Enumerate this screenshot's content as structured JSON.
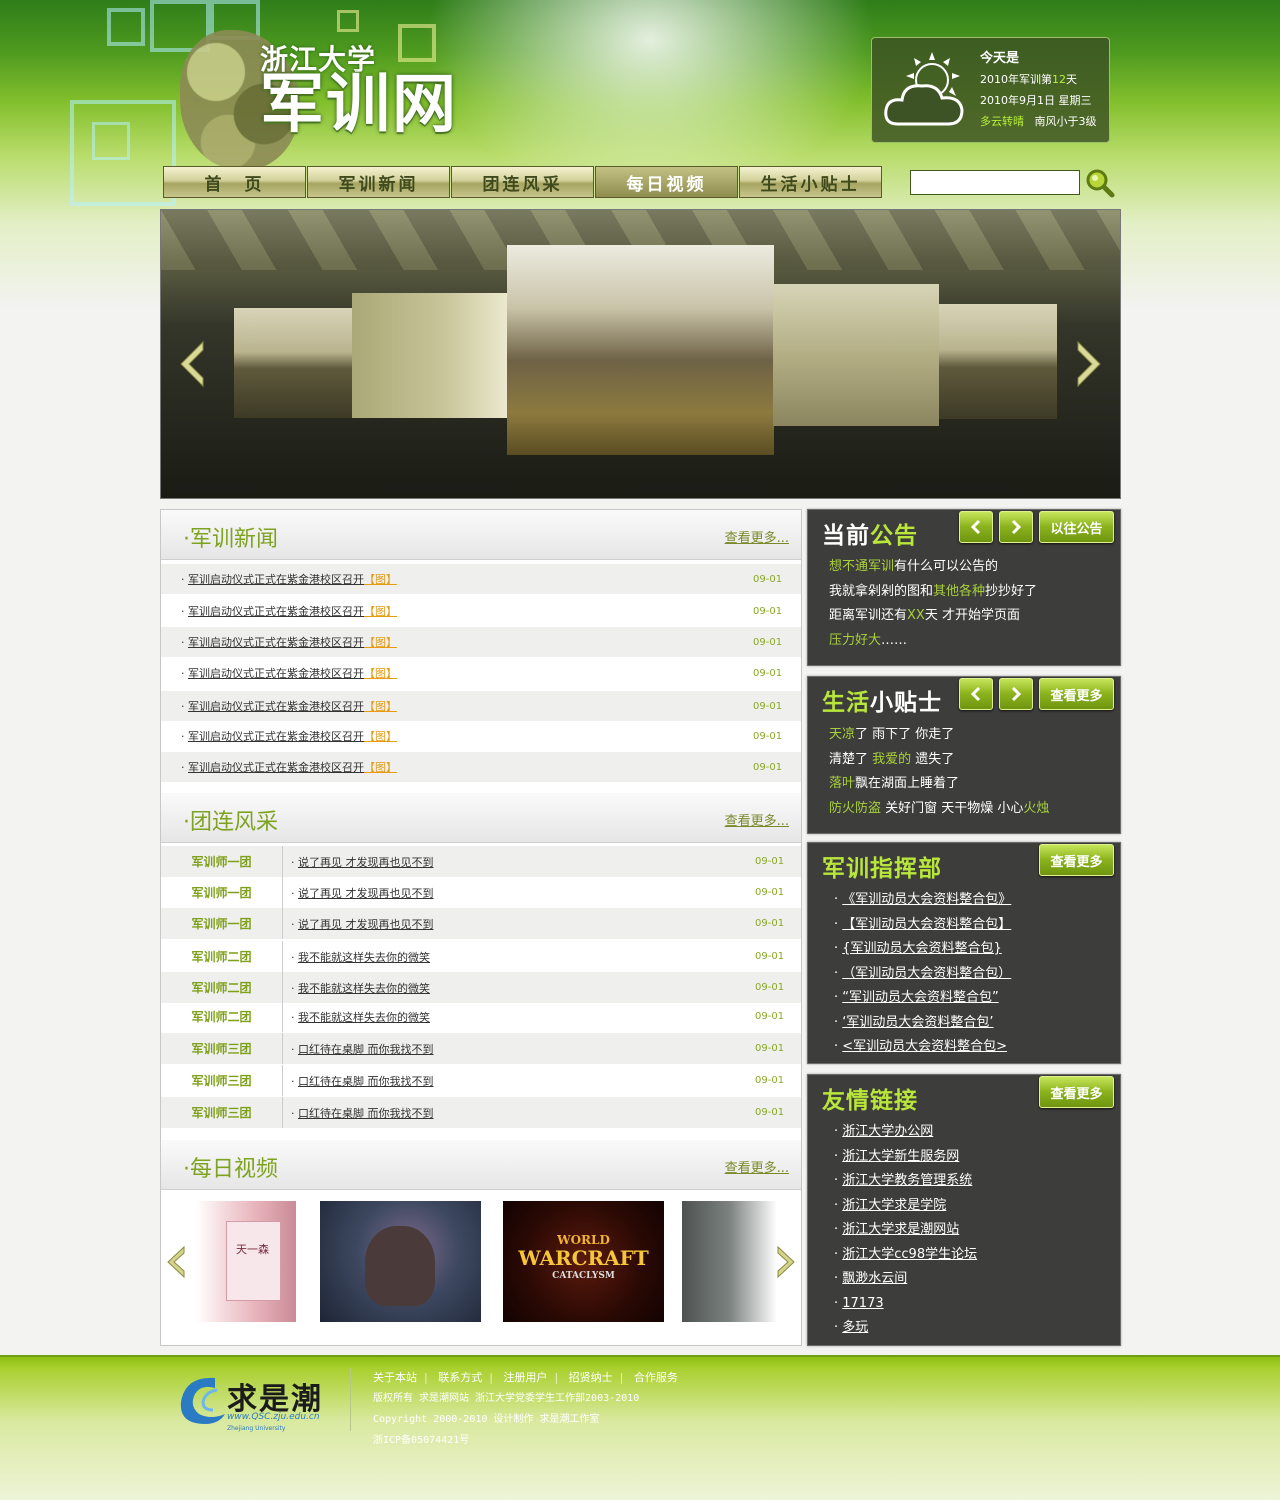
{
  "header": {
    "logo_small": "浙江大学",
    "logo_big": "军训网"
  },
  "weather": {
    "title": "今天是",
    "line1_prefix": "2010年军训第",
    "line1_day": "12",
    "line1_suffix": "天",
    "line2": "2010年9月1日  星期三",
    "condition": "多云转晴",
    "wind": "南风小于3级",
    "icon": "partly-cloudy-icon"
  },
  "nav": {
    "items": [
      {
        "label": "首　页"
      },
      {
        "label": "军训新闻"
      },
      {
        "label": "团连风采"
      },
      {
        "label": "每日视频"
      },
      {
        "label": "生活小贴士"
      }
    ],
    "search_placeholder": ""
  },
  "news": {
    "title": "·军训新闻",
    "more": "查看更多...",
    "img_tag": "【图】",
    "items": [
      {
        "title": "军训启动仪式正式在紫金港校区召开",
        "date": "09-01"
      },
      {
        "title": "军训启动仪式正式在紫金港校区召开",
        "date": "09-01"
      },
      {
        "title": "军训启动仪式正式在紫金港校区召开",
        "date": "09-01"
      },
      {
        "title": "军训启动仪式正式在紫金港校区召开",
        "date": "09-01"
      },
      {
        "title": "军训启动仪式正式在紫金港校区召开",
        "date": "09-01"
      },
      {
        "title": "军训启动仪式正式在紫金港校区召开",
        "date": "09-01"
      },
      {
        "title": "军训启动仪式正式在紫金港校区召开",
        "date": "09-01"
      }
    ]
  },
  "tuanlian": {
    "title": "·团连风采",
    "more": "查看更多...",
    "items": [
      {
        "unit": "军训师一团",
        "title": "说了再见  才发现再也见不到",
        "date": "09-01"
      },
      {
        "unit": "军训师一团",
        "title": "说了再见  才发现再也见不到",
        "date": "09-01"
      },
      {
        "unit": "军训师一团",
        "title": "说了再见  才发现再也见不到",
        "date": "09-01"
      },
      {
        "unit": "军训师二团",
        "title": "我不能就这样失去你的微笑",
        "date": "09-01"
      },
      {
        "unit": "军训师二团",
        "title": "我不能就这样失去你的微笑",
        "date": "09-01"
      },
      {
        "unit": "军训师二团",
        "title": "我不能就这样失去你的微笑",
        "date": "09-01"
      },
      {
        "unit": "军训师三团",
        "title": "口红待在桌脚  而你我找不到",
        "date": "09-01"
      },
      {
        "unit": "军训师三团",
        "title": "口红待在桌脚  而你我找不到",
        "date": "09-01"
      },
      {
        "unit": "军训师三团",
        "title": "口红待在桌脚  而你我找不到",
        "date": "09-01"
      }
    ]
  },
  "video": {
    "title": "·每日视频",
    "more": "查看更多...",
    "thumb1_text": "天一森",
    "thumb3_line1": "WORLD",
    "thumb3_line2": "WARCRAFT",
    "thumb3_line3": "CATACLYSM"
  },
  "notice": {
    "title_a": "当前",
    "title_b": "公告",
    "btn": "以往公告",
    "l1_a": "想不通军训",
    "l1_b": "有什么可以公告的",
    "l2_a": "我就拿剁剁的图和",
    "l2_b": "其他各种",
    "l2_c": "抄抄好了",
    "l3_a": "距离军训还有",
    "l3_b": "XX",
    "l3_c": "天  才开始学页面",
    "l4_a": "压力好大",
    "l4_b": "……"
  },
  "tips": {
    "title_a": "生活",
    "title_b": "小贴士",
    "btn": "查看更多",
    "l1_a": "天凉",
    "l1_b": "了  雨下了  你走了",
    "l2_a": "清楚了  ",
    "l2_b": "我爱的",
    "l2_c": "  遗失了",
    "l3_a": "落叶",
    "l3_b": "飘在湖面上睡着了",
    "l4_a": "防火防盗",
    "l4_b": "  关好门窗  天干物燥  小心",
    "l4_c": "火烛"
  },
  "command": {
    "title_a": "军训",
    "title_b": "指挥部",
    "btn": "查看更多",
    "items": [
      "《军训动员大会资料整合包》",
      "【军训动员大会资料整合包】",
      "{军训动员大会资料整合包}",
      "（军训动员大会资料整合包）",
      "“军训动员大会资料整合包”",
      "‘军训动员大会资料整合包’",
      "<军训动员大会资料整合包>"
    ]
  },
  "links": {
    "title_a": "友情",
    "title_b": "链接",
    "btn": "查看更多",
    "items": [
      "浙江大学办公网",
      "浙江大学新生服务网",
      "浙江大学教务管理系统",
      "浙江大学求是学院",
      "浙江大学求是潮网站",
      "浙江大学cc98学生论坛",
      "飘渺水云间",
      "17173",
      "多玩"
    ]
  },
  "footer": {
    "logo_text": "求是潮",
    "logo_url_text": "www.QSC.zju.edu.cn",
    "logo_sub": "Zhejiang University",
    "links": [
      "关于本站",
      "联系方式",
      "注册用户",
      "招贤纳士",
      "合作服务"
    ],
    "line1": "版权所有 求是潮网站 浙江大学党委学生工作部2003-2010",
    "line2": "Copyright 2000-2010 设计制作 求是潮工作室",
    "line3": "浙ICP备05074421号"
  }
}
